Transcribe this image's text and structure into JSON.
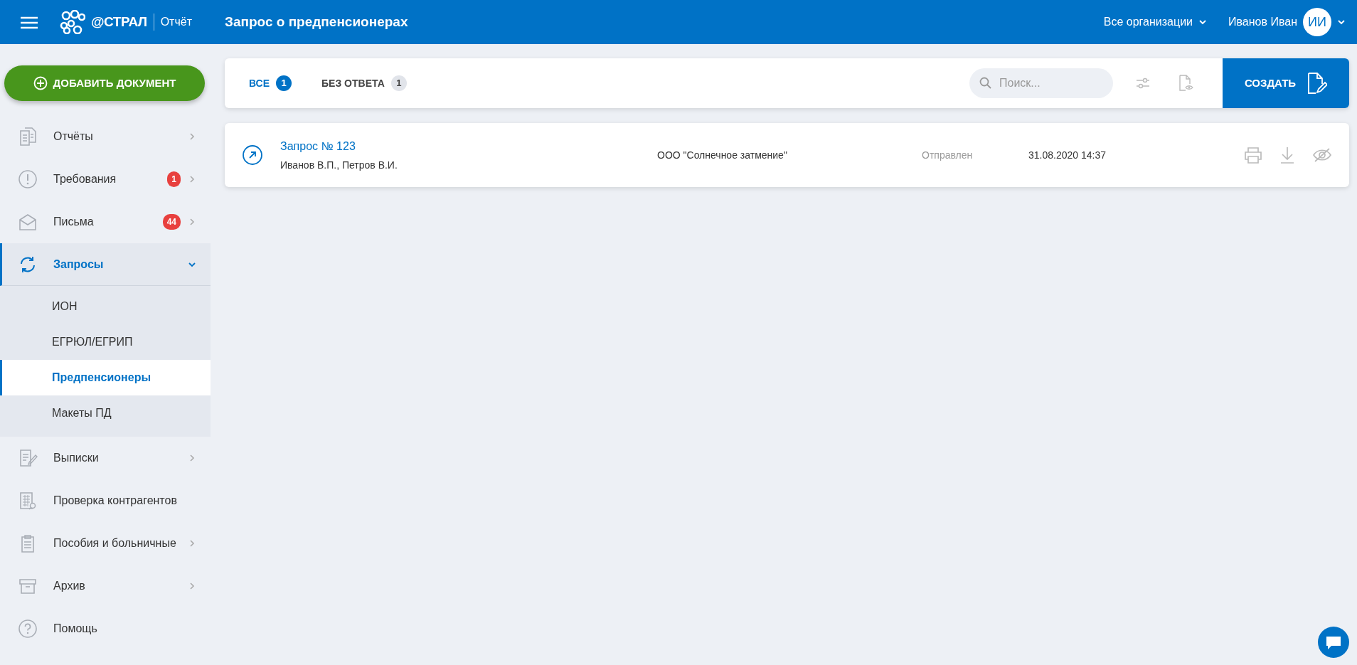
{
  "header": {
    "product": "Отчёт",
    "brand": "@СТРАЛ",
    "title": "Запрос о предпенсионерах",
    "org_selector": "Все организации",
    "user_name": "Иванов Иван",
    "user_initials": "ИИ"
  },
  "add_button": "ДОБАВИТЬ ДОКУМЕНТ",
  "sidebar": {
    "items": [
      {
        "label": "Отчёты",
        "selected": false,
        "expandable": true,
        "expanded": false
      },
      {
        "label": "Требования",
        "badge": "1",
        "selected": false,
        "expandable": true,
        "expanded": false
      },
      {
        "label": "Письма",
        "badge": "44",
        "selected": false,
        "expandable": true,
        "expanded": false
      },
      {
        "label": "Запросы",
        "selected": true,
        "expandable": true,
        "expanded": true,
        "children": [
          {
            "label": "ИОН",
            "selected": false
          },
          {
            "label": "ЕГРЮЛ/ЕГРИП",
            "selected": false
          },
          {
            "label": "Предпенсионеры",
            "selected": true
          },
          {
            "label": "Макеты ПД",
            "selected": false
          }
        ]
      },
      {
        "label": "Выписки",
        "selected": false,
        "expandable": true,
        "expanded": false
      },
      {
        "label": "Проверка контрагентов",
        "selected": false,
        "expandable": false
      },
      {
        "label": "Пособия и больничные",
        "selected": false,
        "expandable": true,
        "expanded": false
      },
      {
        "label": "Архив",
        "selected": false,
        "expandable": true,
        "expanded": false
      },
      {
        "label": "Помощь",
        "selected": false,
        "expandable": false
      }
    ]
  },
  "tabs": [
    {
      "label": "ВСЕ",
      "count": "1",
      "selected": true
    },
    {
      "label": "БЕЗ ОТВЕТА",
      "count": "1",
      "selected": false
    }
  ],
  "search": {
    "placeholder": "Поиск..."
  },
  "create_button": "СОЗДАТЬ",
  "rows": [
    {
      "title": "Запрос № 123",
      "people": "Иванов В.П., Петров В.И.",
      "organization": "ООО \"Солнечное затмение\"",
      "status": "Отправлен",
      "date": "31.08.2020 14:37"
    }
  ]
}
